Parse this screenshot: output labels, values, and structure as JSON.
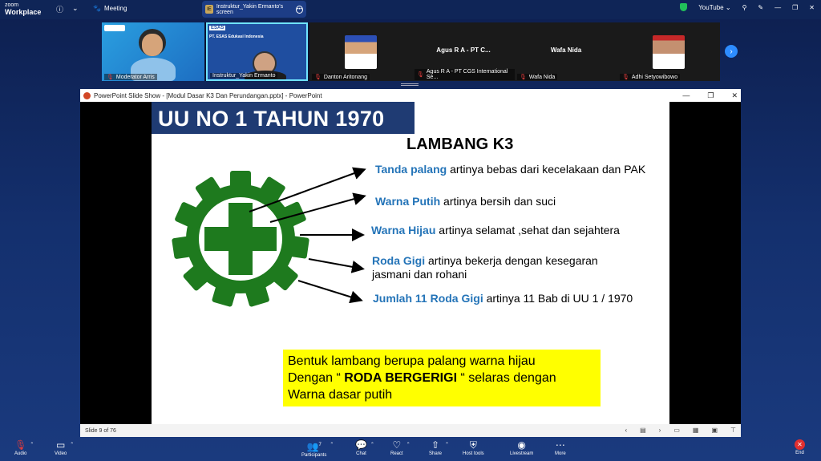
{
  "app": {
    "logo_line1": "zoom",
    "logo_line2": "Workplace"
  },
  "topbar": {
    "info_icon": "info-icon",
    "meeting_label": "Meeting",
    "screen_tab": {
      "badge": "IE",
      "label": "Instruktur_Yakin Ermanto's screen"
    },
    "youtube_label": "YouTube"
  },
  "participants": [
    {
      "name": "Moderator Arris"
    },
    {
      "name": "Instruktur_Yakin Ermanto"
    },
    {
      "name": "Danton Aritonang"
    },
    {
      "name": "Agus R A - PT CGS International Se...",
      "center_label": "Agus R A - PT C..."
    },
    {
      "name": "Wafa Nida",
      "center_label": "Wafa Nida"
    },
    {
      "name": "Adhi Setyowibowo"
    }
  ],
  "tile2_card": {
    "brand": "ESAS",
    "org": "PT. ESAS Edukasi Indonesia"
  },
  "ppt": {
    "window_title": "PowerPoint Slide Show - [Modul Dasar K3 Dan Perundangan.pptx] - PowerPoint",
    "slide_status": "Slide 9 of 76"
  },
  "slide": {
    "heading": "UU NO 1 TAHUN 1970",
    "subtitle": "LAMBANG K3",
    "items": [
      {
        "key": "Tanda palang",
        "text": " artinya bebas dari kecelakaan dan PAK"
      },
      {
        "key": "Warna Putih",
        "text": " artinya bersih dan suci"
      },
      {
        "key": "Warna Hijau",
        "text": "  artinya selamat ,sehat dan sejahtera"
      },
      {
        "key": "Roda Gigi",
        "text": " artinya bekerja dengan kesegaran jasmani dan rohani"
      },
      {
        "key": "Jumlah 11 Roda Gigi",
        "text": "  artinya 11 Bab di UU 1 / 1970"
      }
    ],
    "box": {
      "line1": "Bentuk lambang berupa palang warna hijau",
      "line2_pre": "Dengan “ ",
      "line2_bold": "RODA BERGERIGI",
      "line2_post": " “ selaras dengan",
      "line3": "Warna dasar putih"
    }
  },
  "toolbar": {
    "audio": "Audio",
    "video": "Video",
    "participants": "Participants",
    "participants_count": "7",
    "chat": "Chat",
    "react": "React",
    "share": "Share",
    "host_tools": "Host tools",
    "livestream": "Livestream",
    "more": "More",
    "end": "End"
  },
  "colors": {
    "accent": "#2d8cff",
    "brand_green": "#1e7a1e",
    "slide_heading_bg": "#1f3b73",
    "key_text": "#2474b8",
    "highlight": "#ffff00"
  }
}
